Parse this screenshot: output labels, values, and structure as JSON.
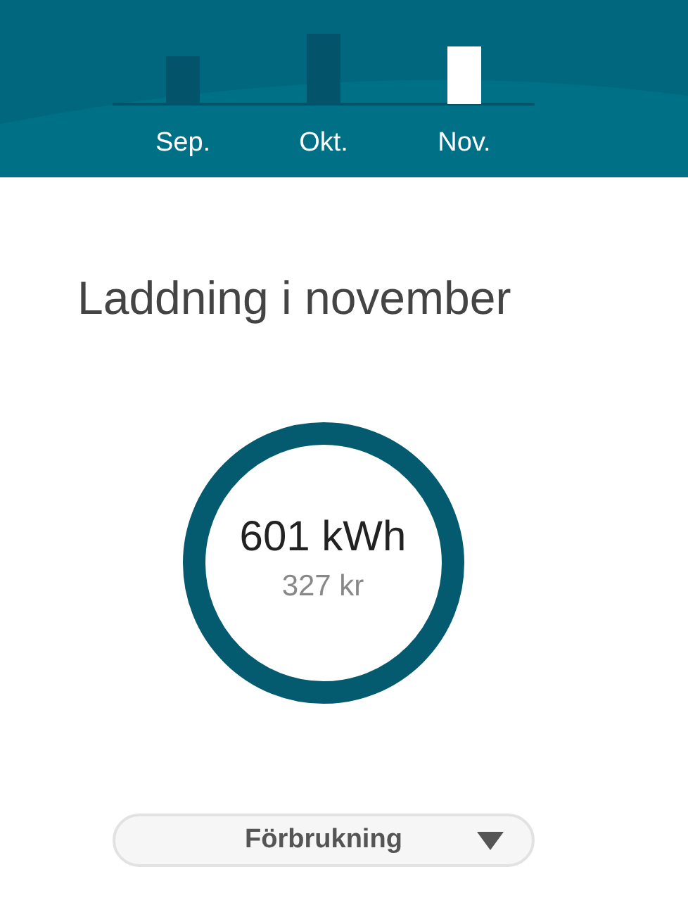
{
  "months": [
    {
      "label": "Sep.",
      "selected": false
    },
    {
      "label": "Okt.",
      "selected": false
    },
    {
      "label": "Nov.",
      "selected": true
    }
  ],
  "title": "Laddning i november",
  "summary": {
    "energy": "601 kWh",
    "cost": "327 kr"
  },
  "dropdown": {
    "label": "Förbrukning"
  }
}
